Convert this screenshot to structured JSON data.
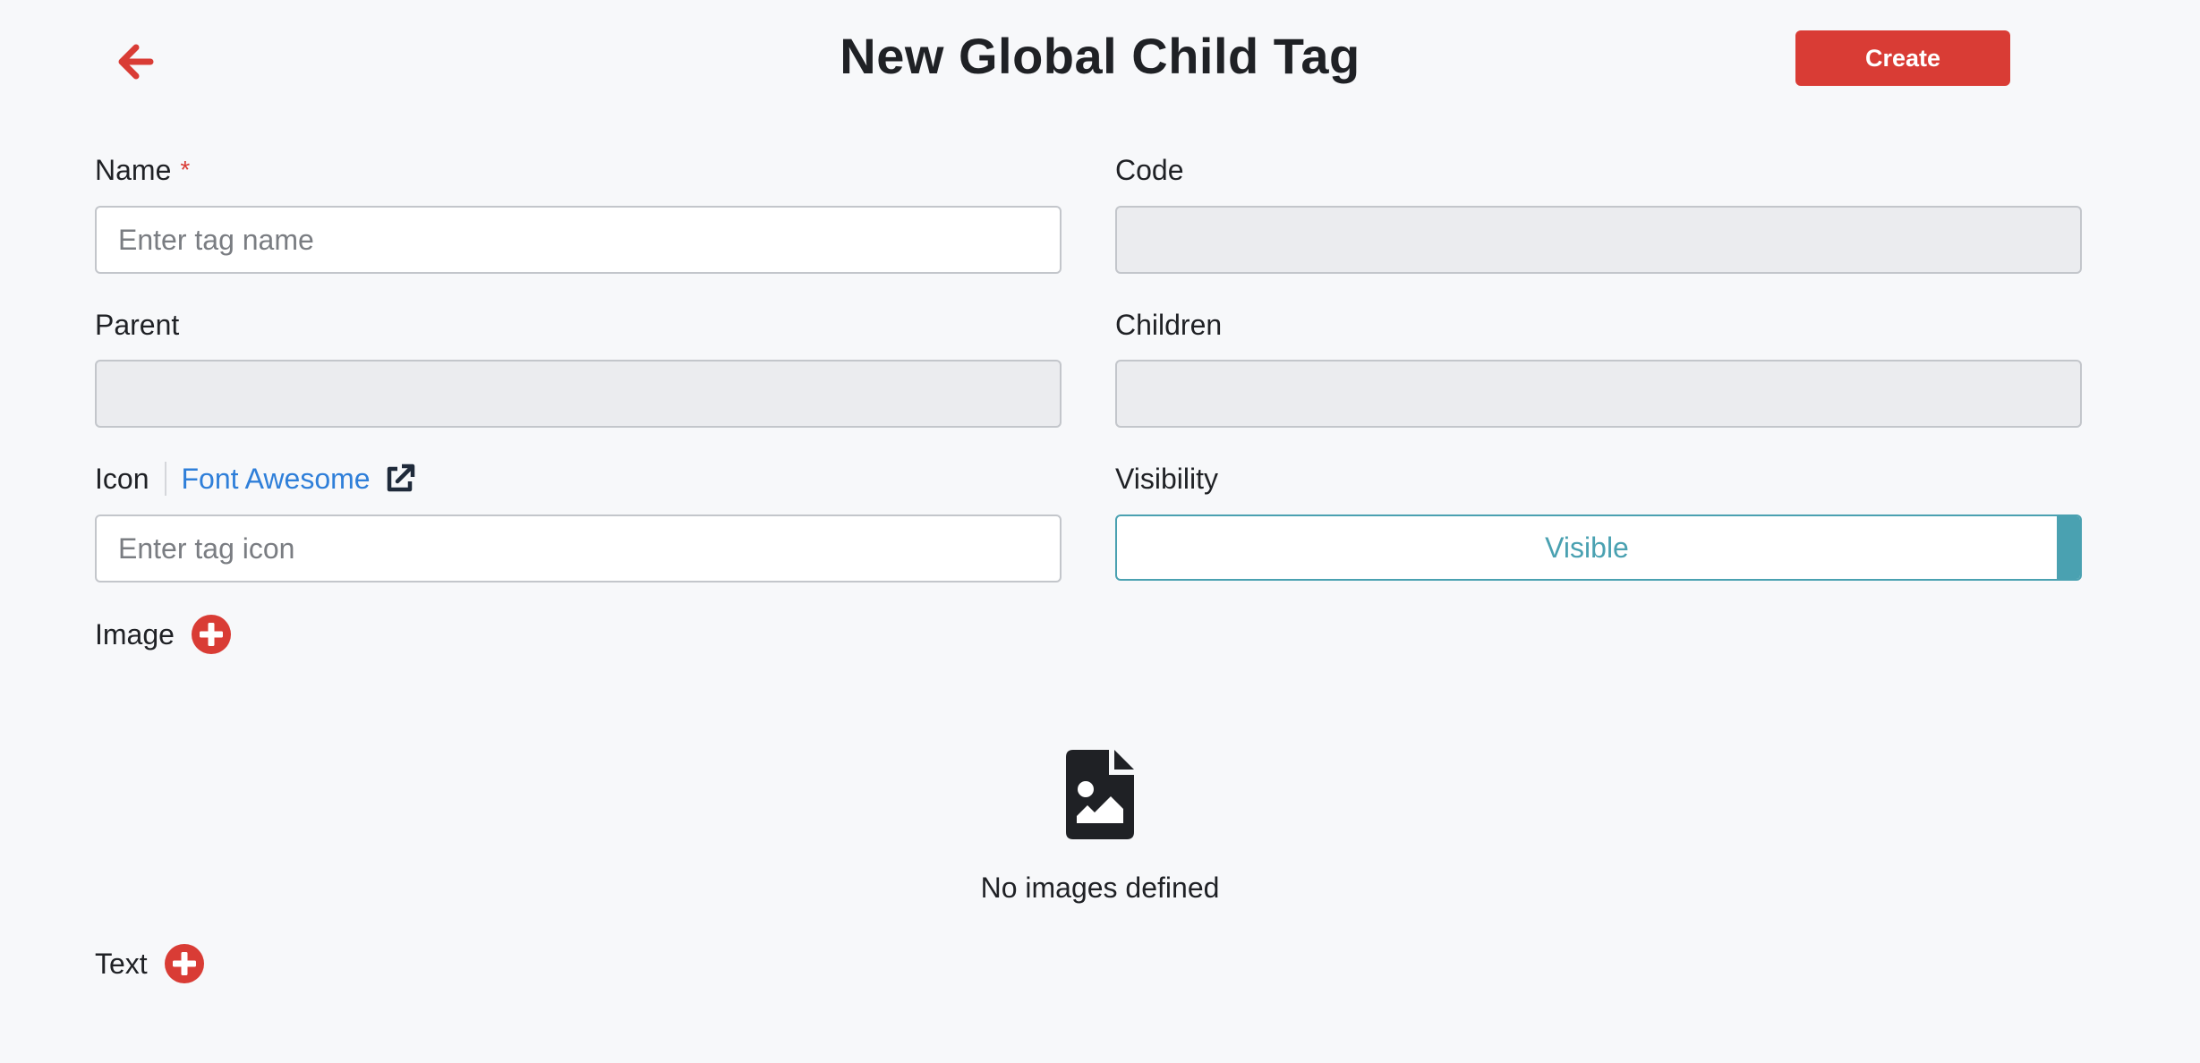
{
  "header": {
    "title": "New Global Child Tag",
    "create_label": "Create"
  },
  "form": {
    "name": {
      "label": "Name",
      "required_mark": "*",
      "placeholder": "Enter tag name",
      "value": ""
    },
    "code": {
      "label": "Code",
      "value": ""
    },
    "parent": {
      "label": "Parent",
      "value": ""
    },
    "children": {
      "label": "Children",
      "value": ""
    },
    "icon": {
      "label": "Icon",
      "link_text": "Font Awesome",
      "placeholder": "Enter tag icon",
      "value": ""
    },
    "visibility": {
      "label": "Visibility",
      "value": "Visible"
    },
    "image": {
      "label": "Image",
      "empty_text": "No images defined"
    },
    "text": {
      "label": "Text"
    }
  },
  "colors": {
    "accent_red": "#d93c35",
    "link_blue": "#2f7fd9",
    "toggle_teal": "#4aa1b1",
    "background": "#f7f8fa"
  },
  "icons": {
    "back": "arrow-left-icon",
    "external_link": "external-link-icon",
    "add": "plus-circle-icon",
    "empty_image": "file-image-icon"
  }
}
